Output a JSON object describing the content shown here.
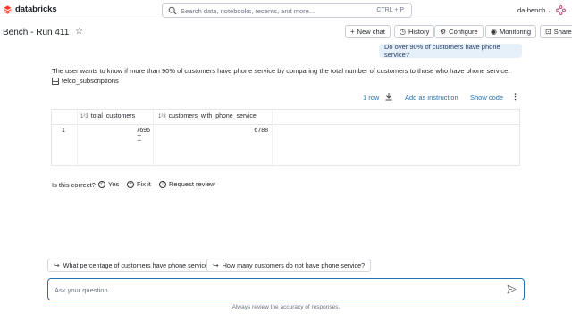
{
  "app": {
    "logo_text": "databricks",
    "brand_color": "#ff3621",
    "search_placeholder": "Search data, notebooks, recents, and more...",
    "search_shortcut": "CTRL + P",
    "account": "da-bench"
  },
  "header": {
    "title": "Bench - Run 411",
    "buttons": {
      "new_chat": "New chat",
      "history": "History",
      "configure": "Configure",
      "monitoring": "Monitoring",
      "share": "Share"
    }
  },
  "chat": {
    "user_message": "Do over 90% of customers have phone service?",
    "response_text": "The user wants to know if more than 90% of customers have phone service by comparing the total number of customers to those who have phone service.",
    "table_name": "telco_subscriptions",
    "row_count": "1 row",
    "add_instruction": "Add as instruction",
    "show_code": "Show code",
    "result": {
      "columns": [
        "total_customers",
        "customers_with_phone_service"
      ],
      "column_type_icon": "1²3",
      "rows": [
        {
          "index": "1",
          "values": [
            "7696",
            "6788"
          ]
        }
      ]
    },
    "feedback": {
      "label": "Is this correct?",
      "yes": "Yes",
      "fix": "Fix it",
      "review": "Request review"
    },
    "suggestions": [
      "What percentage of customers have phone service?",
      "How many customers do not have phone service?"
    ],
    "input_placeholder": "Ask your question...",
    "disclaimer": "Always review the accuracy of responses."
  },
  "colors": {
    "accent": "#2272b4",
    "bubble_bg": "#e6f0fb"
  }
}
